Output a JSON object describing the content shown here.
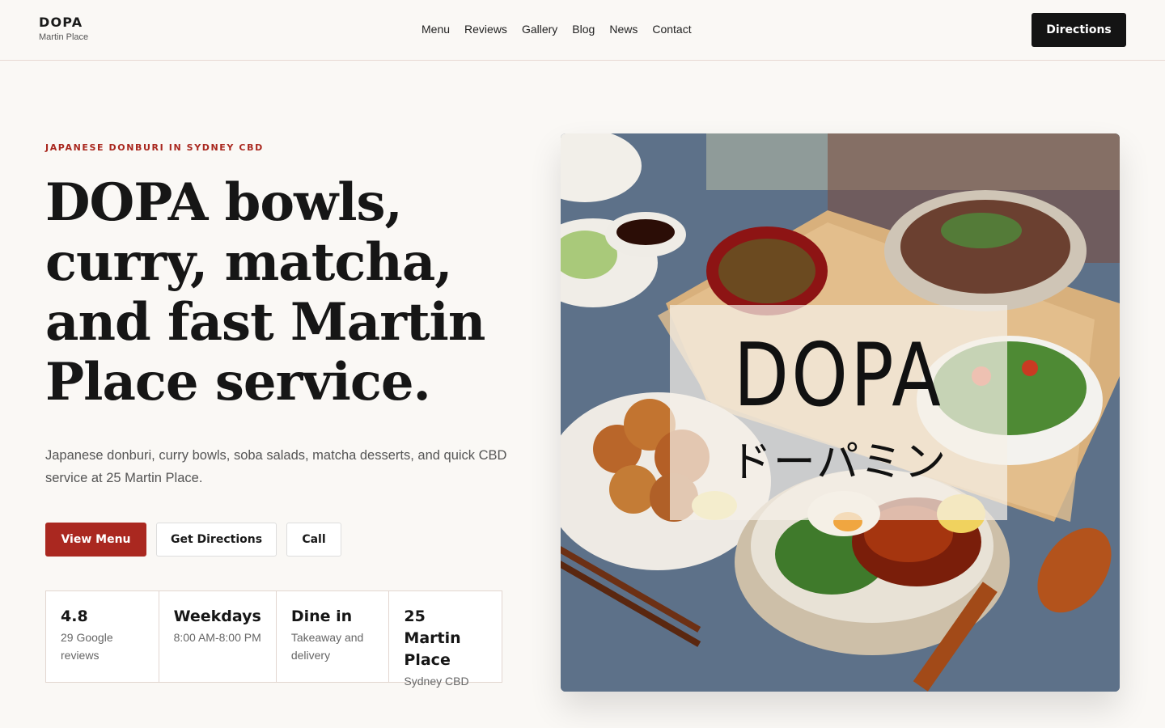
{
  "header": {
    "brand": "DOPA",
    "location": "Martin Place",
    "nav": [
      "Menu",
      "Reviews",
      "Gallery",
      "Blog",
      "News",
      "Contact"
    ],
    "cta": "Directions"
  },
  "hero": {
    "eyebrow": "JAPANESE DONBURI IN SYDNEY CBD",
    "headline": "DOPA bowls, curry, matcha, and fast Martin Place service.",
    "lead": "Japanese donburi, curry bowls, soba salads, matcha desserts, and quick CBD service at 25 Martin Place.",
    "buttons": {
      "menu": "View Menu",
      "directions": "Get Directions",
      "call": "Call"
    },
    "facts": [
      {
        "title": "4.8",
        "sub": "29 Google reviews"
      },
      {
        "title": "Weekdays",
        "sub": "8:00 AM-8:00 PM"
      },
      {
        "title": "Dine in",
        "sub": "Takeaway and delivery"
      },
      {
        "title": "25 Martin Place",
        "sub": "Sydney CBD"
      }
    ],
    "logo": {
      "latin": "DOPA",
      "japanese": "ドーパミン"
    }
  },
  "colors": {
    "accent": "#aa2820",
    "dark": "#141414",
    "background": "#faf8f5"
  }
}
